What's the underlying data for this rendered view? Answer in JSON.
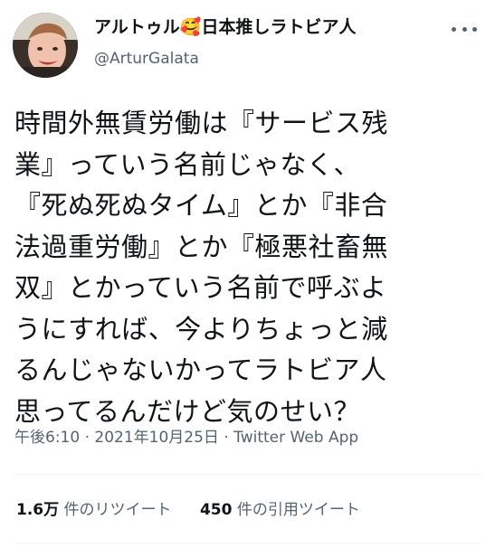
{
  "author": {
    "display_name": "アルトゥル🥰日本推しラトビア人",
    "handle": "@ArturGalata"
  },
  "tweet": {
    "text": "時間外無賃労働は『サービス残\n業』っていう名前じゃなく、\n『死ぬ死ぬタイム』とか『非合\n法過重労働』とか『極悪社畜無\n双』とかっていう名前で呼ぶよ\nうにすれば、今よりちょっと減\nるんじゃないかってラトビア人\n思ってるんだけど気のせい？"
  },
  "meta": {
    "timestamp": "午後6:10 · 2021年10月25日 · Twitter Web App"
  },
  "stats": {
    "retweets_count": "1.6万",
    "retweets_label": "件のリツイート",
    "quotes_count": "450",
    "quotes_label": "件の引用ツイート"
  },
  "icons": {
    "more": "more-horizontal-icon"
  },
  "colors": {
    "text": "#0f1419",
    "secondary": "#536471",
    "divider": "#eff3f4"
  }
}
